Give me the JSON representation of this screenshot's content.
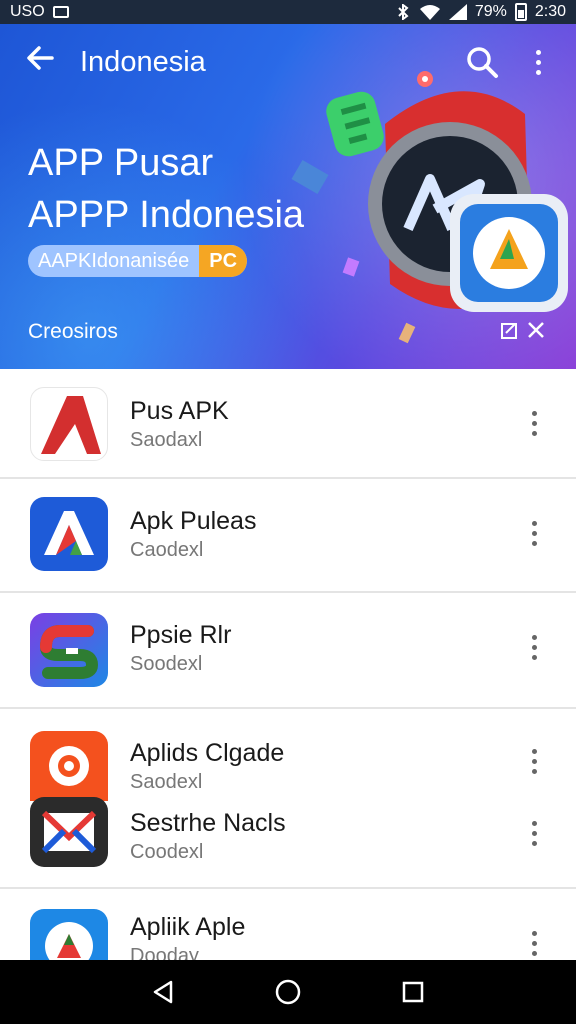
{
  "status_bar": {
    "left_text": "USO",
    "battery": "79%",
    "time": "2:30"
  },
  "header": {
    "title": "Indonesia"
  },
  "hero": {
    "title_line1": "APP Pusar",
    "title_line2": "APPP Indonesia",
    "pill_text": "AAPKIdonanisée",
    "pill_badge": "PC",
    "subtitle": "Creosiros"
  },
  "apps": [
    {
      "name": "Pus APK",
      "subtitle": "Saodaxl",
      "icon": "red-a-icon",
      "color": "#d32f2f"
    },
    {
      "name": "Apk Puleas",
      "subtitle": "Caodexl",
      "icon": "blue-a-icon",
      "color": "#1e5bd8"
    },
    {
      "name": "Ppsie Rlr",
      "subtitle": "Soodexl",
      "icon": "green-s-icon",
      "color": "#2e7d32"
    },
    {
      "name": "Aplids Clgade",
      "subtitle": "Saodexl",
      "icon": "orange-eye-icon",
      "color": "#f4511e"
    },
    {
      "name": "Sestrhe Nacls",
      "subtitle": "Coodexl",
      "icon": "envelope-icon",
      "color": "#2b2b2b"
    },
    {
      "name": "Apliik Aple",
      "subtitle": "Dooday",
      "icon": "compass-icon",
      "color": "#1e88e5"
    }
  ]
}
